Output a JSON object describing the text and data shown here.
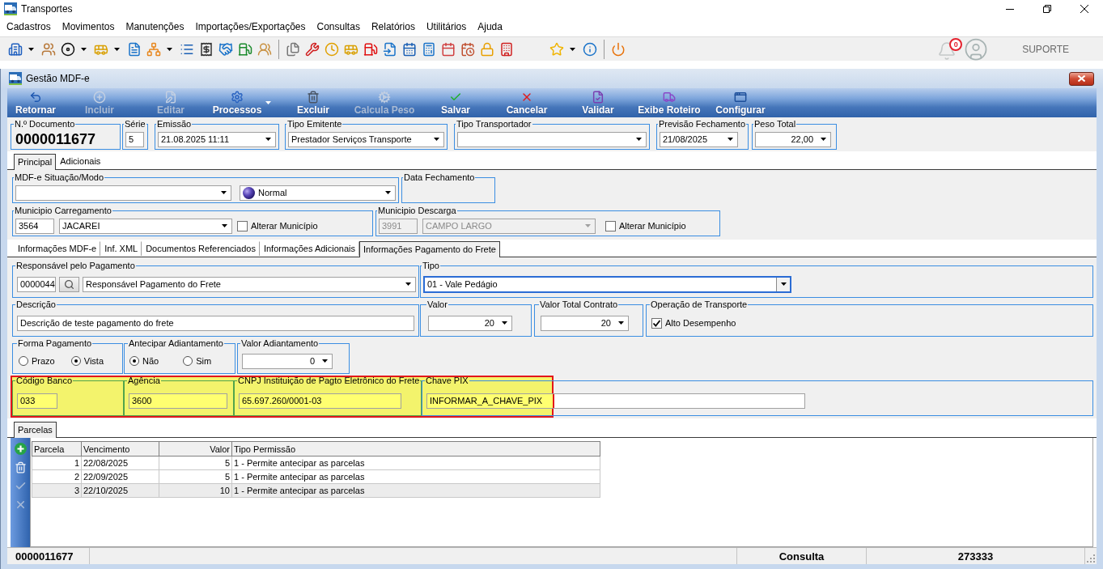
{
  "app": {
    "title": "Transportes",
    "notifications": "0",
    "user": "SUPORTE"
  },
  "menu": [
    "Cadastros",
    "Movimentos",
    "Manutenções",
    "Importações/Exportações",
    "Consultas",
    "Relatórios",
    "Utilitários",
    "Ajuda"
  ],
  "window": {
    "title": "Gestão MDF-e"
  },
  "actions": [
    {
      "label": "Retornar",
      "disabled": false,
      "dropdown": false
    },
    {
      "label": "Incluir",
      "disabled": true,
      "dropdown": false
    },
    {
      "label": "Editar",
      "disabled": true,
      "dropdown": false
    },
    {
      "label": "Processos",
      "disabled": false,
      "dropdown": true
    },
    {
      "label": "Excluir",
      "disabled": false,
      "dropdown": false
    },
    {
      "label": "Calcula Peso",
      "disabled": true,
      "dropdown": false
    },
    {
      "label": "Salvar",
      "disabled": false,
      "dropdown": false
    },
    {
      "label": "Cancelar",
      "disabled": false,
      "dropdown": false
    },
    {
      "label": "Validar",
      "disabled": false,
      "dropdown": false
    },
    {
      "label": "Exibe Roteiro",
      "disabled": false,
      "dropdown": false
    },
    {
      "label": "Configurar",
      "disabled": false,
      "dropdown": false
    }
  ],
  "header": {
    "document": {
      "label": "N.º Documento",
      "value": "0000011677"
    },
    "series": {
      "label": "Série",
      "value": "5"
    },
    "issued": {
      "label": "Emissão",
      "value": "21.08.2025 11:11"
    },
    "issuer_type": {
      "label": "Tipo Emitente",
      "value": "Prestador Serviços Transporte"
    },
    "carrier_type": {
      "label": "Tipo Transportador"
    },
    "closing_forecast": {
      "label": "Previsão Fechamento",
      "value": "21/08/2025"
    },
    "total_weight": {
      "label": "Peso Total",
      "value": "22,00"
    }
  },
  "main_tabs": [
    {
      "label": "Principal",
      "selected": true
    },
    {
      "label": "Adicionais",
      "selected": false
    }
  ],
  "principal": {
    "situation": {
      "label": "MDF-e Situação/Modo",
      "mode": "Normal"
    },
    "closing_date": {
      "label": "Data Fechamento"
    },
    "loading": {
      "label": "Municipio Carregamento",
      "code": "3564",
      "city": "JACAREI",
      "disabled": false,
      "change": {
        "label": "Alterar Município",
        "checked": false
      }
    },
    "unloading": {
      "label": "Municipio Descarga",
      "code": "3991",
      "city": "CAMPO LARGO",
      "disabled": true,
      "change": {
        "label": "Alterar Município",
        "checked": false
      }
    }
  },
  "detail_tabs": [
    {
      "label": "Informações MDF-e",
      "selected": false
    },
    {
      "label": "Inf. XML",
      "selected": false
    },
    {
      "label": "Documentos Referenciados",
      "selected": false
    },
    {
      "label": "Informações Adicionais",
      "selected": false
    },
    {
      "label": "Informações Pagamento do Frete",
      "selected": true
    }
  ],
  "payment": {
    "payer": {
      "label": "Responsável pelo Pagamento",
      "code": "0000044",
      "name": "Responsável Pagamento do Frete"
    },
    "type": {
      "label": "Tipo",
      "value": "01 - Vale Pedágio",
      "focused": true
    },
    "description": {
      "label": "Descrição",
      "value": "Descrição de teste pagamento do frete"
    },
    "amount": {
      "label": "Valor",
      "value": "20"
    },
    "contract_total": {
      "label": "Valor Total Contrato",
      "value": "20"
    },
    "operation": {
      "label": "Operação de Transporte",
      "option": {
        "label": "Alto Desempenho",
        "checked": true
      }
    },
    "payment_form": {
      "label": "Forma Pagamento",
      "options": [
        {
          "label": "Prazo",
          "selected": false
        },
        {
          "label": "Vista",
          "selected": true
        }
      ]
    },
    "advance": {
      "label": "Antecipar Adiantamento",
      "options": [
        {
          "label": "Não",
          "selected": true
        },
        {
          "label": "Sim",
          "selected": false
        }
      ]
    },
    "advance_amount": {
      "label": "Valor Adiantamento",
      "value": "0"
    },
    "bank_row": {
      "highlighted": true,
      "fields": [
        {
          "label": "Código Banco",
          "value": "033"
        },
        {
          "label": "Agência",
          "value": "3600"
        },
        {
          "label": "CNPJ Instituição de Pagto Eletrônico do Frete",
          "value": "65.697.260/0001-03"
        },
        {
          "label": "Chave PIX",
          "value": "INFORMAR_A_CHAVE_PIX"
        }
      ]
    }
  },
  "installments": {
    "tabs": [
      {
        "label": "Parcelas",
        "selected": true
      }
    ],
    "tools": [
      {
        "disabled": false
      },
      {
        "disabled": false
      },
      {
        "disabled": true
      },
      {
        "disabled": true
      }
    ],
    "columns": [
      "Parcela",
      "Vencimento",
      "Valor",
      "Tipo Permissão"
    ],
    "rows": [
      {
        "cells": [
          "1",
          "22/08/2025",
          "5",
          "1 - Permite antecipar as parcelas"
        ],
        "selected": false
      },
      {
        "cells": [
          "2",
          "22/09/2025",
          "5",
          "1 - Permite antecipar as parcelas"
        ],
        "selected": false
      },
      {
        "cells": [
          "3",
          "22/10/2025",
          "10",
          "1 - Permite antecipar as parcelas"
        ],
        "selected": true
      }
    ]
  },
  "status_bar": {
    "document": "0000011677",
    "mode": "Consulta",
    "code": "273333"
  }
}
